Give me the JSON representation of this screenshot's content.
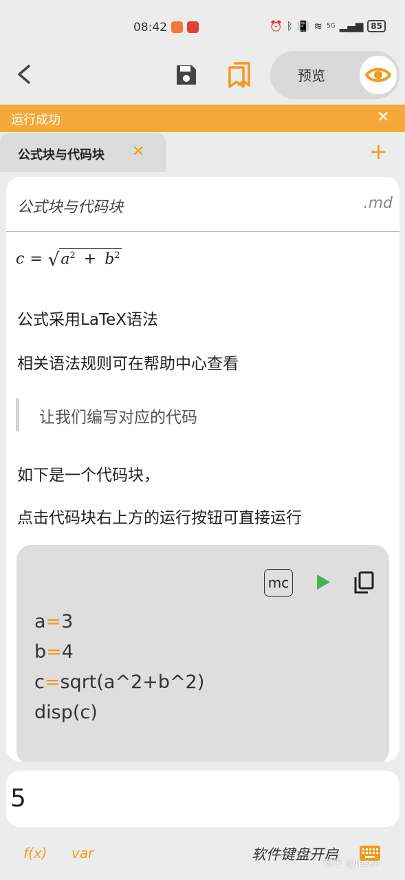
{
  "status_bar": {
    "time": "08:42",
    "network": "5G",
    "battery": "85"
  },
  "toolbar": {
    "preview_label": "预览"
  },
  "banner": {
    "text": "运行成功",
    "close": "✕"
  },
  "tab": {
    "label": "公式块与代码块",
    "close": "✕",
    "add": "+"
  },
  "document": {
    "title": "公式块与代码块",
    "extension": ".md",
    "formula": {
      "lhs": "c",
      "eq": "=",
      "a": "a",
      "b": "b",
      "exp": "2",
      "plus": "+"
    },
    "paragraphs": [
      "公式采用LaTeX语法",
      "相关语法规则可在帮助中心查看"
    ],
    "quote": "让我们编写对应的代码",
    "paragraphs_after": [
      "如下是一个代码块，",
      "点击代码块右上方的运行按钮可直接运行"
    ],
    "code": {
      "mc_label": "mc",
      "lines": [
        {
          "lhs": "a",
          "op": "=",
          "rhs": "3"
        },
        {
          "lhs": "b",
          "op": "=",
          "rhs": "4"
        },
        {
          "lhs": "c",
          "op": "=",
          "rhs": "sqrt(a^2+b^2)"
        },
        {
          "text": "disp(c)"
        }
      ]
    }
  },
  "output": {
    "value": "5"
  },
  "bottom_bar": {
    "fx": "f(x)",
    "var": "var",
    "keyboard_label": "软件键盘开启",
    "watermark": "知乎 @Jesse"
  },
  "colors": {
    "accent": "#f39a1e",
    "banner": "#f5a93a",
    "run": "#4caf50"
  }
}
